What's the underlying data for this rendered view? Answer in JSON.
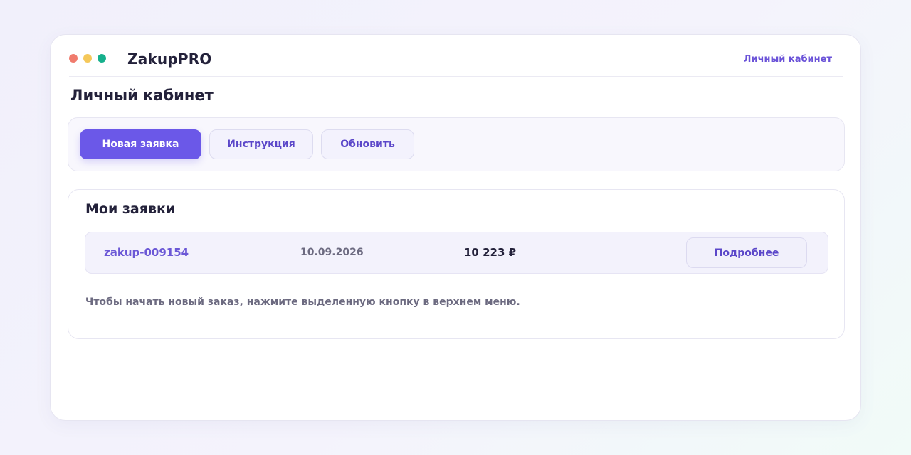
{
  "app": {
    "brand": "ZakupPRO",
    "top_link": "Личный кабинет",
    "window_controls": {
      "red": "#f07b6d",
      "yellow": "#f5c85a",
      "green": "#16b08c"
    }
  },
  "page": {
    "title": "Личный кабинет"
  },
  "toolbar": {
    "new_request_label": "Новая заявка",
    "instructions_label": "Инструкция",
    "refresh_label": "Обновить"
  },
  "orders": {
    "title": "Мои заявки",
    "rows": [
      {
        "id": "zakup-009154",
        "date": "10.09.2026",
        "amount": "10 223 ₽",
        "details_label": "Подробнее"
      }
    ],
    "hint": "Чтобы начать новый заказ, нажмите выделенную кнопку в верхнем меню."
  },
  "colors": {
    "accent": "#6b58e8",
    "link": "#6a52d8",
    "text": "#23213a",
    "muted": "#6c6a80"
  }
}
